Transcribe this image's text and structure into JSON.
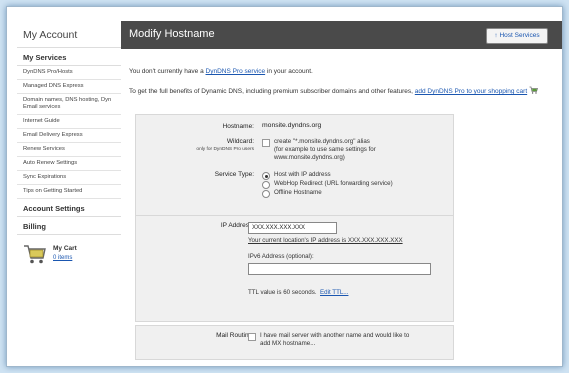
{
  "sidebar": {
    "title": "My Account",
    "sections": {
      "my_services": "My Services",
      "account_settings": "Account Settings",
      "billing": "Billing"
    },
    "items": [
      "DynDNS Pro/Hosts",
      "Managed DNS Express",
      "Domain names, DNS hosting, Dyn Email services",
      "Internet Guide",
      "Email Delivery Express",
      "Renew Services",
      "Auto Renew Settings",
      "Sync Expirations",
      "Tips on Getting Started"
    ],
    "cart": {
      "label": "My Cart",
      "count": "0 items"
    }
  },
  "header": {
    "title": "Modify Hostname",
    "host_services_button": "↑ Host Services"
  },
  "intro": {
    "line1_pre": "You don't currently have a ",
    "line1_link": "DynDNS Pro service",
    "line1_post": " in your account.",
    "line2_pre": "To get the full benefits of Dynamic DNS, including premium subscriber domains and other features, ",
    "line2_link": "add DynDNS Pro to your shopping cart"
  },
  "form": {
    "hostname_label": "Hostname:",
    "hostname_value": "monsite.dyndns.org",
    "wildcard_label": "Wildcard:",
    "wildcard_sublabel": "only for DynDNS Pro users",
    "wildcard_text": "create \"*.monsite.dyndns.org\" alias",
    "wildcard_note1": "(for example to use same settings for",
    "wildcard_note2": "www.monsite.dyndns.org)",
    "service_type_label": "Service Type:",
    "service_options": [
      "Host with IP address",
      "WebHop Redirect (URL forwarding service)",
      "Offline Hostname"
    ],
    "service_selected": 0,
    "ip_label": "IP Address:",
    "ip_value": "XXX.XXX.XXX.XXX",
    "ip_location_link": "Your current location's IP address is XXX.XXX.XXX.XXX",
    "ipv6_label": "IPv6 Address (optional):",
    "ipv6_value": "",
    "ttl_text": "TTL value is 60 seconds.",
    "ttl_link": "Edit TTL...",
    "mail_label": "Mail Routing:",
    "mail_text1": "I have mail server with another name and would like to",
    "mail_text2": "add MX hostname..."
  }
}
